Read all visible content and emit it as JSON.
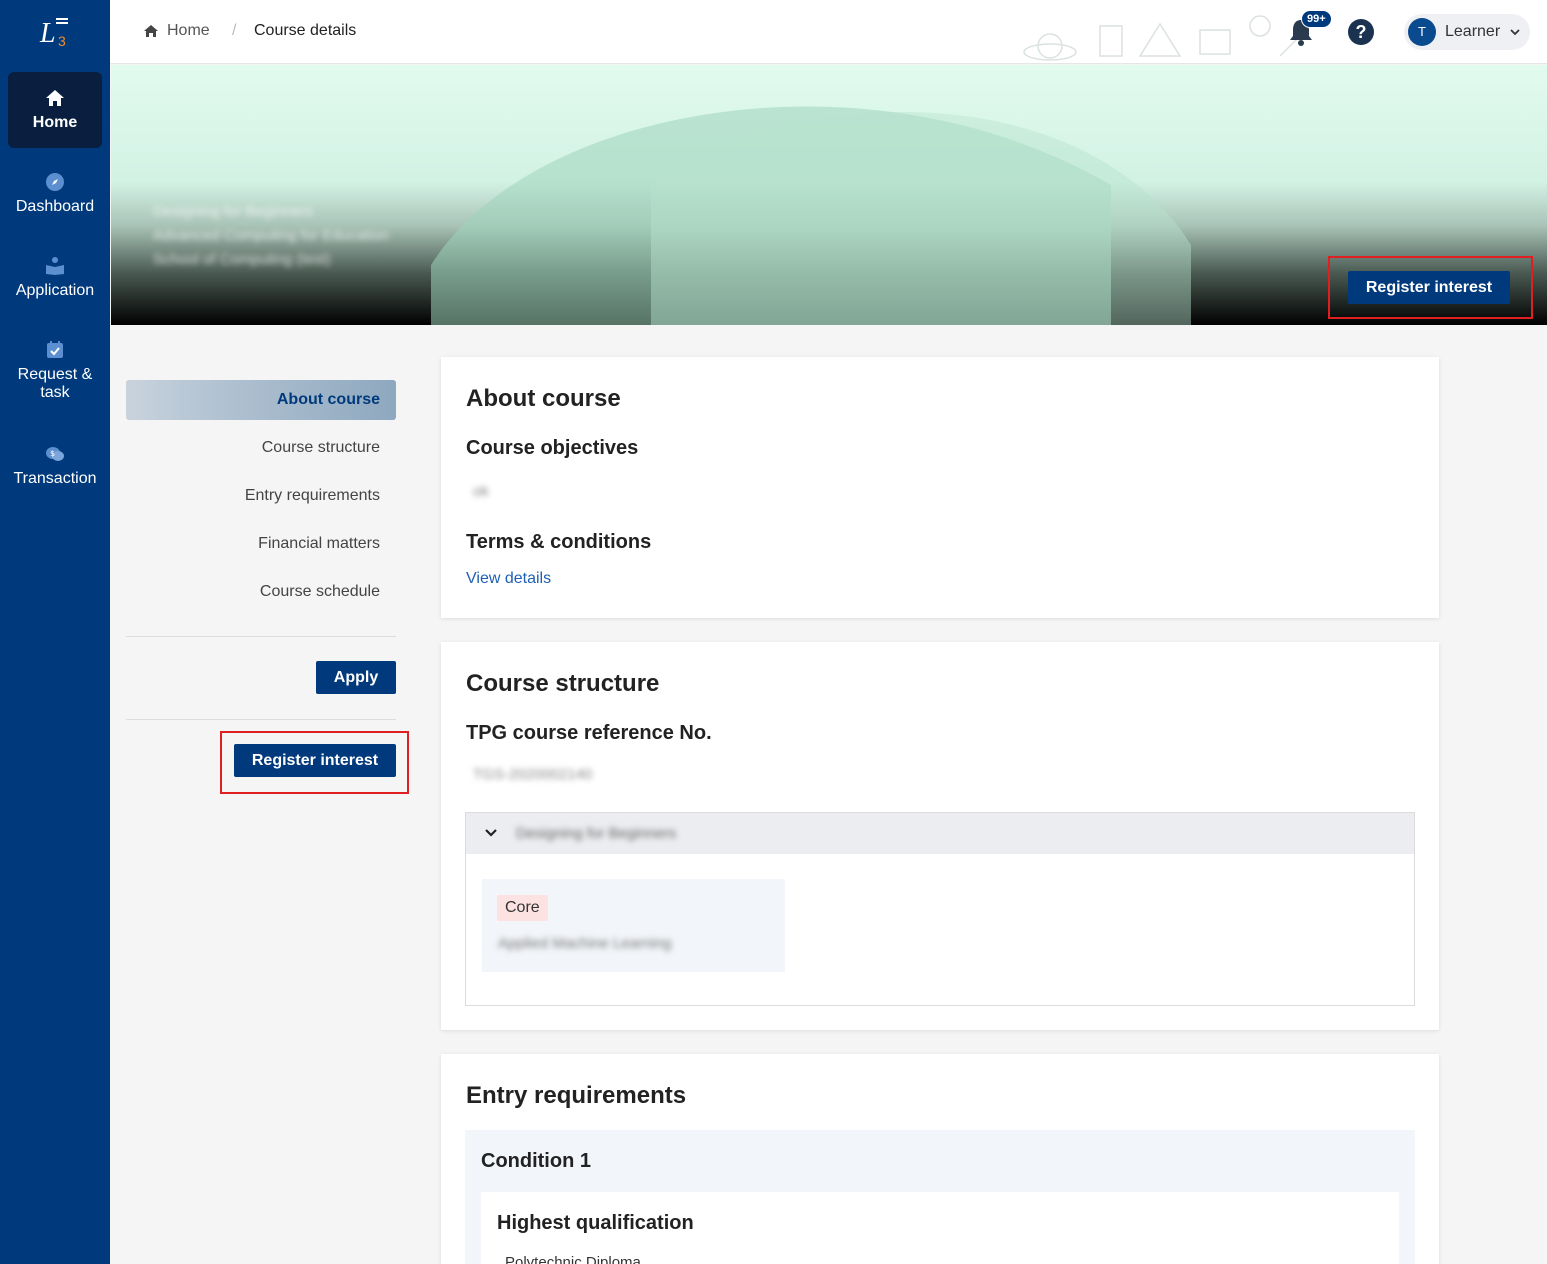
{
  "sidebar": {
    "logo_alt": "L3",
    "items": [
      {
        "label": "Home",
        "icon": "home-icon"
      },
      {
        "label": "Dashboard",
        "icon": "compass-icon"
      },
      {
        "label": "Application",
        "icon": "application-icon"
      },
      {
        "label": "Request &",
        "label2": "task",
        "icon": "calendar-check-icon"
      },
      {
        "label": "Transaction",
        "icon": "transaction-icon"
      }
    ]
  },
  "header": {
    "breadcrumb": {
      "home": "Home",
      "separator": "/",
      "current": "Course details"
    },
    "notifications_badge": "99+",
    "help_symbol": "?",
    "user": {
      "initial": "T",
      "name": "Learner"
    }
  },
  "banner": {
    "blurred_lines": [
      "Designing for Beginners",
      "Advanced Computing for Education",
      "School of Computing (test)"
    ],
    "register_label": "Register interest"
  },
  "page_nav": {
    "items": [
      "About course",
      "Course structure",
      "Entry requirements",
      "Financial matters",
      "Course schedule"
    ],
    "apply_label": "Apply",
    "register_label": "Register interest"
  },
  "about": {
    "title": "About course",
    "objectives_title": "Course objectives",
    "objectives_value": "ok",
    "terms_title": "Terms & conditions",
    "terms_link": "View details"
  },
  "structure": {
    "title": "Course structure",
    "ref_title": "TPG course reference No.",
    "ref_value": "TGS-2020002140",
    "accordion_title": "Designing for Beginners",
    "module_tag": "Core",
    "module_name": "Applied Machine Learning"
  },
  "entry": {
    "title": "Entry requirements",
    "condition_title": "Condition 1",
    "qualification_title": "Highest qualification",
    "qualification_value": "Polytechnic Diploma"
  },
  "colors": {
    "sidebar": "#003a7c",
    "primary_button": "#003a7c",
    "highlight_outline": "#e02020",
    "link": "#1f5fb5"
  }
}
